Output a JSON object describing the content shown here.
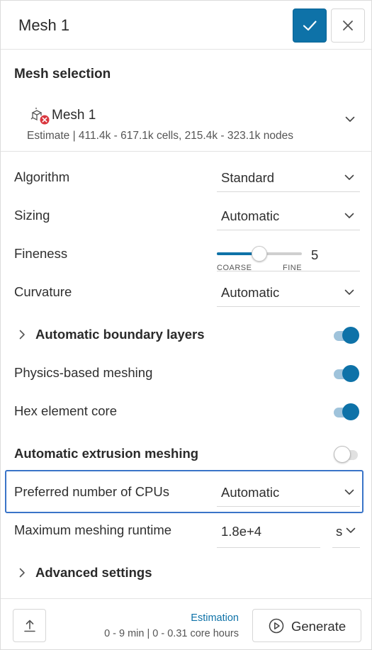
{
  "header": {
    "title": "Mesh 1"
  },
  "mesh_selection": {
    "section_title": "Mesh selection",
    "mesh_name": "Mesh 1",
    "estimate": "Estimate | 411.4k - 617.1k cells, 215.4k - 323.1k nodes"
  },
  "algorithm": {
    "label": "Algorithm",
    "value": "Standard"
  },
  "sizing": {
    "label": "Sizing",
    "value": "Automatic"
  },
  "fineness": {
    "label": "Fineness",
    "value": "5",
    "min_label": "COARSE",
    "max_label": "FINE",
    "level_fraction": 0.5
  },
  "curvature": {
    "label": "Curvature",
    "value": "Automatic"
  },
  "automatic_boundary_layers": {
    "label": "Automatic boundary layers",
    "enabled": true
  },
  "physics_based_meshing": {
    "label": "Physics-based meshing",
    "enabled": true
  },
  "hex_element_core": {
    "label": "Hex element core",
    "enabled": true
  },
  "automatic_extrusion_meshing": {
    "label": "Automatic extrusion meshing",
    "enabled": false
  },
  "preferred_cpus": {
    "label": "Preferred number of CPUs",
    "value": "Automatic"
  },
  "max_runtime": {
    "label": "Maximum meshing runtime",
    "value": "1.8e+4",
    "unit": "s"
  },
  "advanced_settings": {
    "label": "Advanced settings"
  },
  "footer": {
    "estimation_label": "Estimation",
    "estimation_value": "0 - 9 min | 0 - 0.31 core hours",
    "generate_label": "Generate"
  },
  "colors": {
    "accent": "#0e72a8",
    "highlight": "#3a74c8",
    "error_badge": "#d9363e"
  }
}
